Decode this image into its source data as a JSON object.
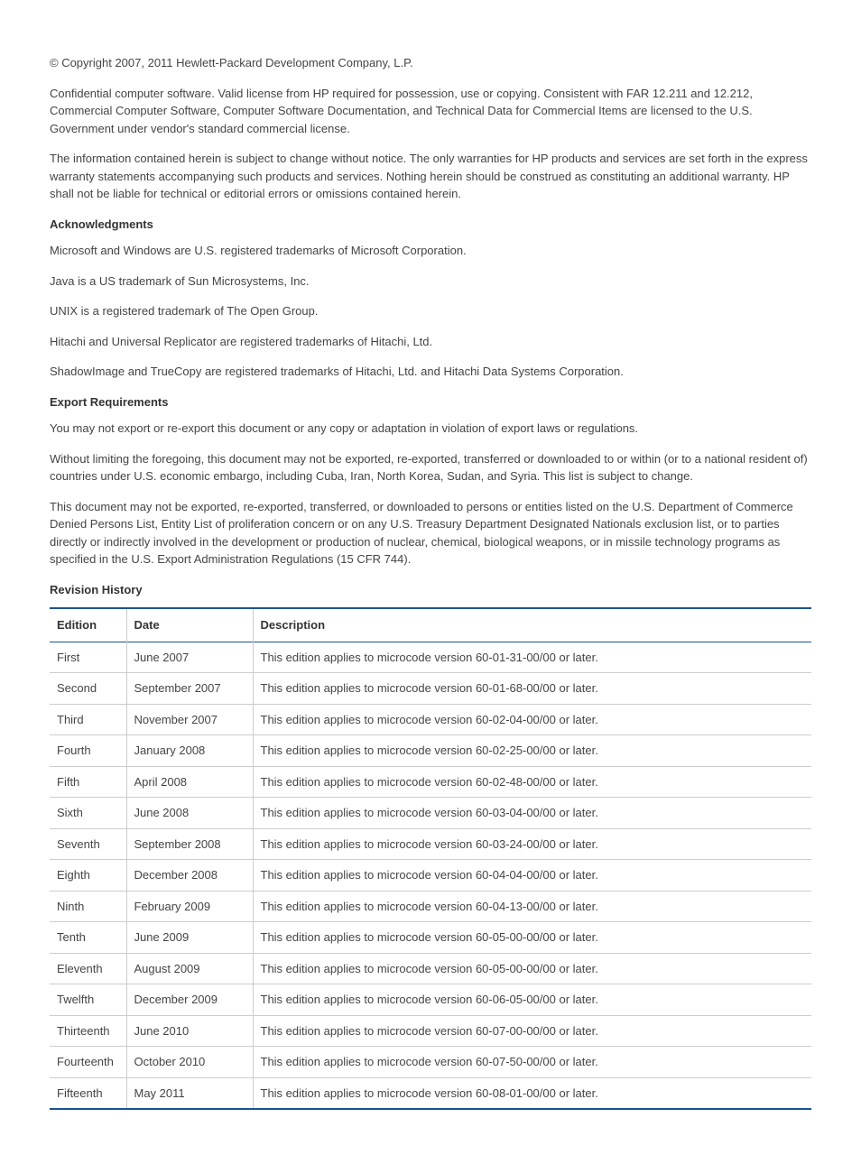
{
  "copyright": "© Copyright 2007, 2011 Hewlett-Packard Development Company, L.P.",
  "paragraphs": {
    "confidential": "Confidential computer software. Valid license from HP required for possession, use or copying. Consistent with FAR 12.211 and 12.212, Commercial Computer Software, Computer Software Documentation, and Technical Data for Commercial Items are licensed to the U.S. Government under vendor's standard commercial license.",
    "warranty": "The information contained herein is subject to change without notice. The only warranties for HP products and services are set forth in the express warranty statements accompanying such products and services. Nothing herein should be construed as constituting an additional warranty. HP shall not be liable for technical or editorial errors or omissions contained herein."
  },
  "headings": {
    "acknowledgments": "Acknowledgments",
    "export": "Export Requirements",
    "revision": "Revision History"
  },
  "acknowledgments": {
    "microsoft": "Microsoft and Windows are U.S. registered trademarks of Microsoft Corporation.",
    "java": "Java is a US trademark of Sun Microsystems, Inc.",
    "unix": "UNIX is a registered trademark of The Open Group.",
    "hitachi": "Hitachi and Universal Replicator are registered trademarks of Hitachi, Ltd.",
    "shadowimage": "ShadowImage and TrueCopy are registered trademarks of Hitachi, Ltd. and Hitachi Data Systems Corporation."
  },
  "export": {
    "p1": "You may not export or re-export this document or any copy or adaptation in violation of export laws or regulations.",
    "p2": "Without limiting the foregoing, this document may not be exported, re-exported, transferred or downloaded to or within (or to a national resident of) countries under U.S. economic embargo, including Cuba, Iran, North Korea, Sudan, and Syria. This list is subject to change.",
    "p3": "This document may not be exported, re-exported, transferred, or downloaded to persons or entities listed on the U.S. Department of Commerce Denied Persons List, Entity List of proliferation concern or on any U.S. Treasury Department Designated Nationals exclusion list, or to parties directly or indirectly involved in the development or production of nuclear, chemical, biological weapons, or in missile technology programs as specified in the U.S. Export Administration Regulations (15 CFR 744)."
  },
  "table": {
    "headers": {
      "edition": "Edition",
      "date": "Date",
      "description": "Description"
    },
    "rows": [
      {
        "edition": "First",
        "date": "June 2007",
        "description": "This edition applies to microcode version 60-01-31-00/00 or later."
      },
      {
        "edition": "Second",
        "date": "September 2007",
        "description": "This edition applies to microcode version 60-01-68-00/00 or later."
      },
      {
        "edition": "Third",
        "date": "November 2007",
        "description": "This edition applies to microcode version 60-02-04-00/00 or later."
      },
      {
        "edition": "Fourth",
        "date": "January 2008",
        "description": "This edition applies to microcode version 60-02-25-00/00 or later."
      },
      {
        "edition": "Fifth",
        "date": "April 2008",
        "description": "This edition applies to microcode version 60-02-48-00/00 or later."
      },
      {
        "edition": "Sixth",
        "date": "June 2008",
        "description": "This edition applies to microcode version 60-03-04-00/00 or later."
      },
      {
        "edition": "Seventh",
        "date": "September 2008",
        "description": "This edition applies to microcode version 60-03-24-00/00 or later."
      },
      {
        "edition": "Eighth",
        "date": "December 2008",
        "description": "This edition applies to microcode version 60-04-04-00/00 or later."
      },
      {
        "edition": "Ninth",
        "date": "February 2009",
        "description": "This edition applies to microcode version 60-04-13-00/00 or later."
      },
      {
        "edition": "Tenth",
        "date": "June 2009",
        "description": "This edition applies to microcode version 60-05-00-00/00 or later."
      },
      {
        "edition": "Eleventh",
        "date": "August 2009",
        "description": "This edition applies to microcode version 60-05-00-00/00 or later."
      },
      {
        "edition": "Twelfth",
        "date": "December 2009",
        "description": "This edition applies to microcode version 60-06-05-00/00 or later."
      },
      {
        "edition": "Thirteenth",
        "date": "June 2010",
        "description": "This edition applies to microcode version 60-07-00-00/00 or later."
      },
      {
        "edition": "Fourteenth",
        "date": "October 2010",
        "description": "This edition applies to microcode version 60-07-50-00/00 or later."
      },
      {
        "edition": "Fifteenth",
        "date": "May 2011",
        "description": "This edition applies to microcode version 60-08-01-00/00 or later."
      }
    ]
  }
}
